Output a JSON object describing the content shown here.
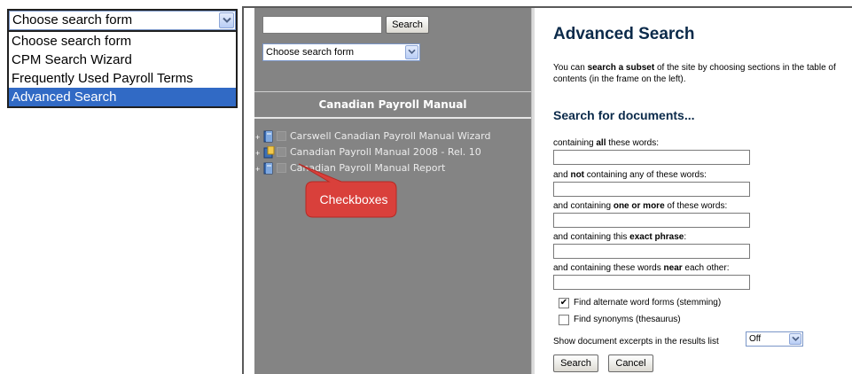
{
  "dropdown_example": {
    "selected": "Choose search form",
    "options": [
      "Choose search form",
      "CPM Search Wizard",
      "Frequently Used Payroll Terms",
      "Advanced Search"
    ],
    "highlighted_index": 3
  },
  "nav_frame": {
    "search_button": "Search",
    "search_input_value": "",
    "form_select": "Choose search form",
    "manual_title": "Canadian Payroll Manual",
    "tree": [
      {
        "label": "Carswell Canadian Payroll Manual Wizard",
        "icon": "book-icon"
      },
      {
        "label": "Canadian Payroll Manual 2008 - Rel. 10",
        "icon": "book-open-icon"
      },
      {
        "label": "Canadian Payroll Manual Report",
        "icon": "book-icon"
      }
    ],
    "expand_glyph": "+",
    "callout": "Checkboxes"
  },
  "advanced_search": {
    "title": "Advanced Search",
    "intro": {
      "part1": "You can ",
      "bold": "search a subset",
      "part2": " of the site by choosing sections in the table of contents (in the frame on the left)."
    },
    "documents_heading": "Search for documents...",
    "fields": [
      {
        "pre": "containing ",
        "bold": "all",
        "post": " these words:",
        "value": ""
      },
      {
        "pre": "and ",
        "bold": "not",
        "post": " containing any of these words:",
        "value": ""
      },
      {
        "pre": "and containing ",
        "bold": "one or more",
        "post": " of these words:",
        "value": ""
      },
      {
        "pre": "and containing this ",
        "bold": "exact phrase",
        "post": ":",
        "value": ""
      },
      {
        "pre": "and containing these words ",
        "bold": "near",
        "post": " each other:",
        "value": ""
      }
    ],
    "options": [
      {
        "label": "Find alternate word forms (stemming)",
        "checked": true,
        "mark": "✔"
      },
      {
        "label": "Find synonyms (thesaurus)",
        "checked": false,
        "mark": ""
      }
    ],
    "excerpts_label": "Show document excerpts in the results list",
    "excerpts_value": "Off",
    "search_button": "Search",
    "cancel_button": "Cancel"
  },
  "colors": {
    "nav_background": "#848484",
    "dropdown_highlight": "#316ac5",
    "callout_fill": "#d9403b",
    "heading_color": "#0b2a4a"
  }
}
